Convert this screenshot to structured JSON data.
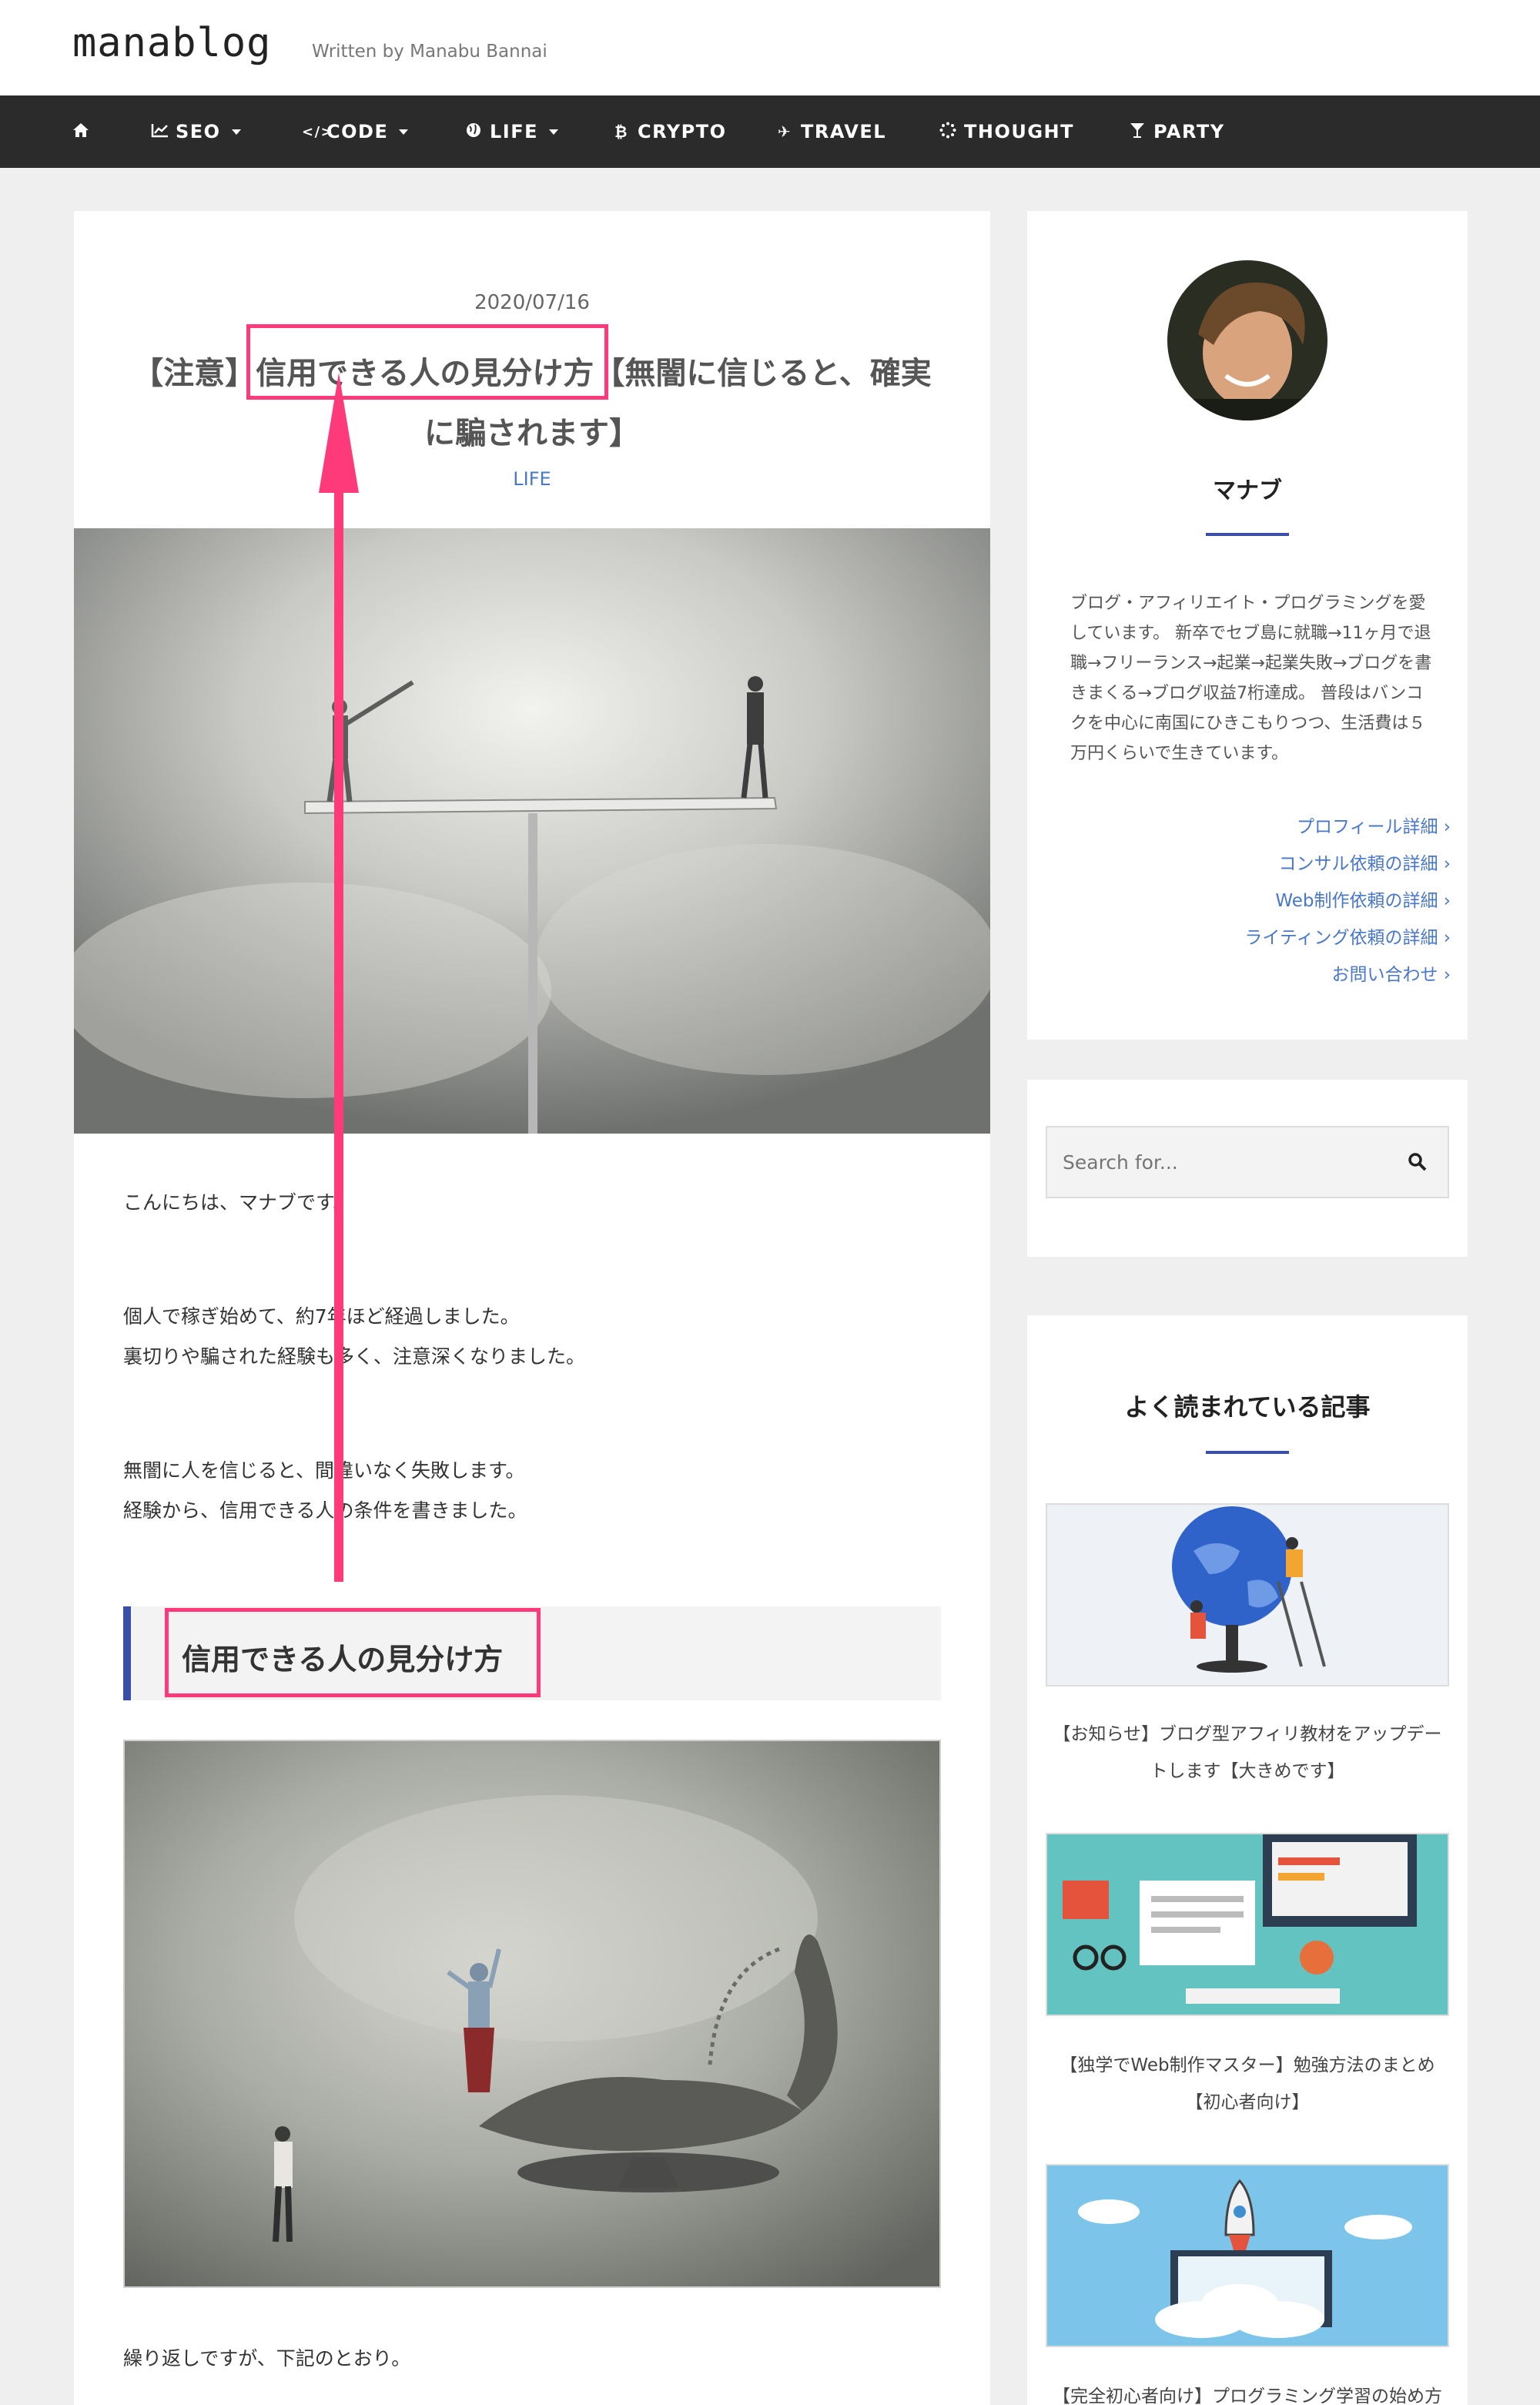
{
  "header": {
    "logo": "manablog",
    "tagline": "Written by Manabu Bannai"
  },
  "nav": {
    "items": [
      {
        "label": "",
        "icon": "home-icon"
      },
      {
        "label": "SEO",
        "icon": "line-chart-icon",
        "dropdown": true
      },
      {
        "label": "CODE",
        "icon": "code-icon",
        "dropdown": true
      },
      {
        "label": "LIFE",
        "icon": "globe-icon",
        "dropdown": true
      },
      {
        "label": "CRYPTO",
        "icon": "bitcoin-icon",
        "dropdown": false
      },
      {
        "label": "TRAVEL",
        "icon": "plane-icon",
        "dropdown": false
      },
      {
        "label": "THOUGHT",
        "icon": "spinner-icon",
        "dropdown": false
      },
      {
        "label": "PARTY",
        "icon": "cocktail-icon",
        "dropdown": false
      }
    ]
  },
  "article": {
    "date": "2020/07/16",
    "title_line1": "【注意】信用できる人の見分け方【無闇に信じると、確実",
    "title_line2": "に騙されます】",
    "category": "LIFE",
    "paragraphs": [
      "こんにちは、マナブです。",
      "個人で稼ぎ始めて、約7年ほど経過しました。",
      "裏切りや騙された経験も多く、注意深くなりました。",
      "無闇に人を信じると、間違いなく失敗します。",
      "経験から、信用できる人の条件を書きました。"
    ],
    "heading": "信用できる人の見分け方",
    "closing": "繰り返しですが、下記のとおり。"
  },
  "profile": {
    "name": "マナブ",
    "bio": "ブログ・アフィリエイト・プログラミングを愛しています。 新卒でセブ島に就職→11ヶ月で退職→フリーランス→起業→起業失敗→ブログを書きまくる→ブログ収益7桁達成。 普段はバンコクを中心に南国にひきこもりつつ、生活費は５万円くらいで生きています。",
    "links": [
      "プロフィール詳細 ›",
      "コンサル依頼の詳細 ›",
      "Web制作依頼の詳細 ›",
      "ライティング依頼の詳細 ›",
      "お問い合わせ ›"
    ]
  },
  "search": {
    "placeholder": "Search for..."
  },
  "popular": {
    "title": "よく読まれている記事",
    "posts": [
      {
        "line1": "【お知らせ】ブログ型アフィリ教材をアップデー",
        "line2": "トします【大きめです】"
      },
      {
        "line1": "【独学でWeb制作マスター】勉強方法のまとめ",
        "line2": "【初心者向け】"
      },
      {
        "line1": "【完全初心者向け】プログラミング学習の始め方",
        "line2": ""
      }
    ]
  },
  "colors": {
    "nav_bg": "#2b2b2b",
    "accent": "#3c4fa8",
    "link": "#4a78c8",
    "annotation": "#ff3a7a"
  }
}
